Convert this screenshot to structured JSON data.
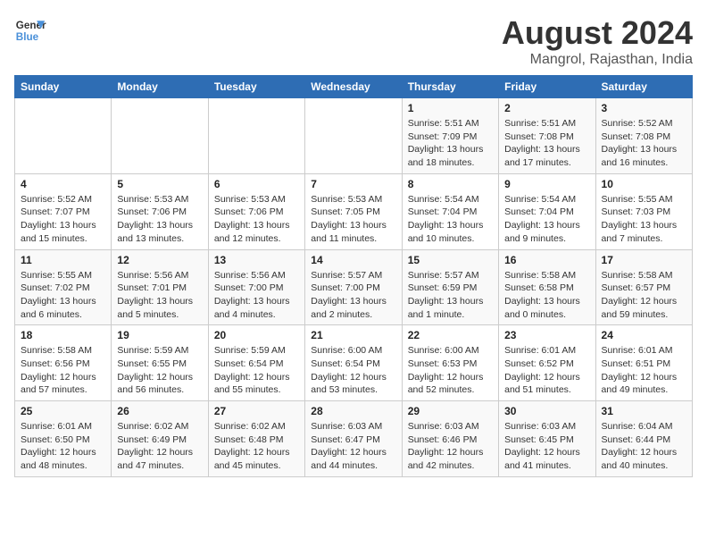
{
  "logo": {
    "name1": "General",
    "name2": "Blue"
  },
  "title": "August 2024",
  "subtitle": "Mangrol, Rajasthan, India",
  "days": [
    "Sunday",
    "Monday",
    "Tuesday",
    "Wednesday",
    "Thursday",
    "Friday",
    "Saturday"
  ],
  "weeks": [
    [
      {
        "date": "",
        "info": ""
      },
      {
        "date": "",
        "info": ""
      },
      {
        "date": "",
        "info": ""
      },
      {
        "date": "",
        "info": ""
      },
      {
        "date": "1",
        "info": "Sunrise: 5:51 AM\nSunset: 7:09 PM\nDaylight: 13 hours and 18 minutes."
      },
      {
        "date": "2",
        "info": "Sunrise: 5:51 AM\nSunset: 7:08 PM\nDaylight: 13 hours and 17 minutes."
      },
      {
        "date": "3",
        "info": "Sunrise: 5:52 AM\nSunset: 7:08 PM\nDaylight: 13 hours and 16 minutes."
      }
    ],
    [
      {
        "date": "4",
        "info": "Sunrise: 5:52 AM\nSunset: 7:07 PM\nDaylight: 13 hours and 15 minutes."
      },
      {
        "date": "5",
        "info": "Sunrise: 5:53 AM\nSunset: 7:06 PM\nDaylight: 13 hours and 13 minutes."
      },
      {
        "date": "6",
        "info": "Sunrise: 5:53 AM\nSunset: 7:06 PM\nDaylight: 13 hours and 12 minutes."
      },
      {
        "date": "7",
        "info": "Sunrise: 5:53 AM\nSunset: 7:05 PM\nDaylight: 13 hours and 11 minutes."
      },
      {
        "date": "8",
        "info": "Sunrise: 5:54 AM\nSunset: 7:04 PM\nDaylight: 13 hours and 10 minutes."
      },
      {
        "date": "9",
        "info": "Sunrise: 5:54 AM\nSunset: 7:04 PM\nDaylight: 13 hours and 9 minutes."
      },
      {
        "date": "10",
        "info": "Sunrise: 5:55 AM\nSunset: 7:03 PM\nDaylight: 13 hours and 7 minutes."
      }
    ],
    [
      {
        "date": "11",
        "info": "Sunrise: 5:55 AM\nSunset: 7:02 PM\nDaylight: 13 hours and 6 minutes."
      },
      {
        "date": "12",
        "info": "Sunrise: 5:56 AM\nSunset: 7:01 PM\nDaylight: 13 hours and 5 minutes."
      },
      {
        "date": "13",
        "info": "Sunrise: 5:56 AM\nSunset: 7:00 PM\nDaylight: 13 hours and 4 minutes."
      },
      {
        "date": "14",
        "info": "Sunrise: 5:57 AM\nSunset: 7:00 PM\nDaylight: 13 hours and 2 minutes."
      },
      {
        "date": "15",
        "info": "Sunrise: 5:57 AM\nSunset: 6:59 PM\nDaylight: 13 hours and 1 minute."
      },
      {
        "date": "16",
        "info": "Sunrise: 5:58 AM\nSunset: 6:58 PM\nDaylight: 13 hours and 0 minutes."
      },
      {
        "date": "17",
        "info": "Sunrise: 5:58 AM\nSunset: 6:57 PM\nDaylight: 12 hours and 59 minutes."
      }
    ],
    [
      {
        "date": "18",
        "info": "Sunrise: 5:58 AM\nSunset: 6:56 PM\nDaylight: 12 hours and 57 minutes."
      },
      {
        "date": "19",
        "info": "Sunrise: 5:59 AM\nSunset: 6:55 PM\nDaylight: 12 hours and 56 minutes."
      },
      {
        "date": "20",
        "info": "Sunrise: 5:59 AM\nSunset: 6:54 PM\nDaylight: 12 hours and 55 minutes."
      },
      {
        "date": "21",
        "info": "Sunrise: 6:00 AM\nSunset: 6:54 PM\nDaylight: 12 hours and 53 minutes."
      },
      {
        "date": "22",
        "info": "Sunrise: 6:00 AM\nSunset: 6:53 PM\nDaylight: 12 hours and 52 minutes."
      },
      {
        "date": "23",
        "info": "Sunrise: 6:01 AM\nSunset: 6:52 PM\nDaylight: 12 hours and 51 minutes."
      },
      {
        "date": "24",
        "info": "Sunrise: 6:01 AM\nSunset: 6:51 PM\nDaylight: 12 hours and 49 minutes."
      }
    ],
    [
      {
        "date": "25",
        "info": "Sunrise: 6:01 AM\nSunset: 6:50 PM\nDaylight: 12 hours and 48 minutes."
      },
      {
        "date": "26",
        "info": "Sunrise: 6:02 AM\nSunset: 6:49 PM\nDaylight: 12 hours and 47 minutes."
      },
      {
        "date": "27",
        "info": "Sunrise: 6:02 AM\nSunset: 6:48 PM\nDaylight: 12 hours and 45 minutes."
      },
      {
        "date": "28",
        "info": "Sunrise: 6:03 AM\nSunset: 6:47 PM\nDaylight: 12 hours and 44 minutes."
      },
      {
        "date": "29",
        "info": "Sunrise: 6:03 AM\nSunset: 6:46 PM\nDaylight: 12 hours and 42 minutes."
      },
      {
        "date": "30",
        "info": "Sunrise: 6:03 AM\nSunset: 6:45 PM\nDaylight: 12 hours and 41 minutes."
      },
      {
        "date": "31",
        "info": "Sunrise: 6:04 AM\nSunset: 6:44 PM\nDaylight: 12 hours and 40 minutes."
      }
    ]
  ]
}
